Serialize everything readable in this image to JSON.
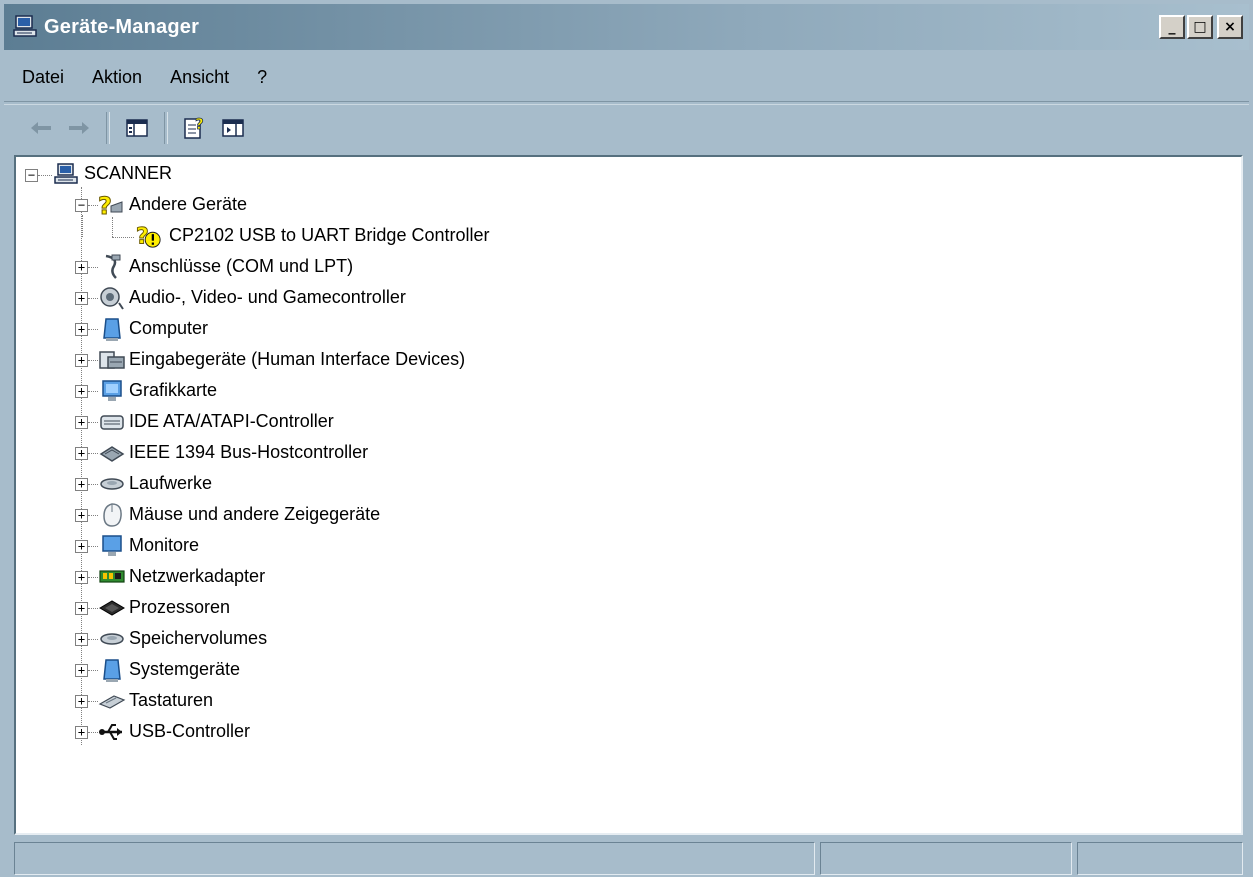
{
  "window": {
    "title": "Geräte-Manager",
    "controls": {
      "minimize": "_",
      "maximize": "□",
      "close": "×"
    }
  },
  "menu": {
    "items": [
      {
        "label": "Datei"
      },
      {
        "label": "Aktion"
      },
      {
        "label": "Ansicht"
      },
      {
        "label": "?"
      }
    ]
  },
  "toolbar": {
    "buttons": [
      {
        "icon": "back-arrow-icon"
      },
      {
        "icon": "forward-arrow-icon"
      },
      {
        "icon": "show-hide-console-tree-icon"
      },
      {
        "icon": "properties-help-icon"
      },
      {
        "icon": "show-hide-action-pane-icon"
      }
    ]
  },
  "tree": {
    "root": {
      "label": "SCANNER",
      "icon": "computer-icon",
      "expanded": true
    },
    "nodes": [
      {
        "label": "Andere Geräte",
        "icon": "unknown-device-icon",
        "expanded": true
      },
      {
        "label": "CP2102 USB to UART Bridge Controller",
        "icon": "warning-device-icon",
        "child": true
      },
      {
        "label": "Anschlüsse (COM und LPT)",
        "icon": "port-icon"
      },
      {
        "label": "Audio-, Video- und Gamecontroller",
        "icon": "speaker-icon"
      },
      {
        "label": "Computer",
        "icon": "computer-case-icon"
      },
      {
        "label": "Eingabegeräte (Human Interface Devices)",
        "icon": "hid-icon"
      },
      {
        "label": "Grafikkarte",
        "icon": "display-adapter-icon"
      },
      {
        "label": "IDE ATA/ATAPI-Controller",
        "icon": "ide-controller-icon"
      },
      {
        "label": "IEEE 1394 Bus-Hostcontroller",
        "icon": "firewire-icon"
      },
      {
        "label": "Laufwerke",
        "icon": "disk-drive-icon"
      },
      {
        "label": "Mäuse und andere Zeigegeräte",
        "icon": "mouse-icon"
      },
      {
        "label": "Monitore",
        "icon": "monitor-icon"
      },
      {
        "label": "Netzwerkadapter",
        "icon": "network-adapter-icon"
      },
      {
        "label": "Prozessoren",
        "icon": "processor-icon"
      },
      {
        "label": "Speichervolumes",
        "icon": "storage-volume-icon"
      },
      {
        "label": "Systemgeräte",
        "icon": "system-device-icon"
      },
      {
        "label": "Tastaturen",
        "icon": "keyboard-icon"
      },
      {
        "label": "USB-Controller",
        "icon": "usb-icon"
      }
    ]
  },
  "colors": {
    "window_bg": "#a7bccb",
    "title_gradient_start": "#5c7d93",
    "title_gradient_end": "#a8bfce",
    "tree_bg": "#ffffff",
    "warning_yellow": "#ffee00"
  }
}
